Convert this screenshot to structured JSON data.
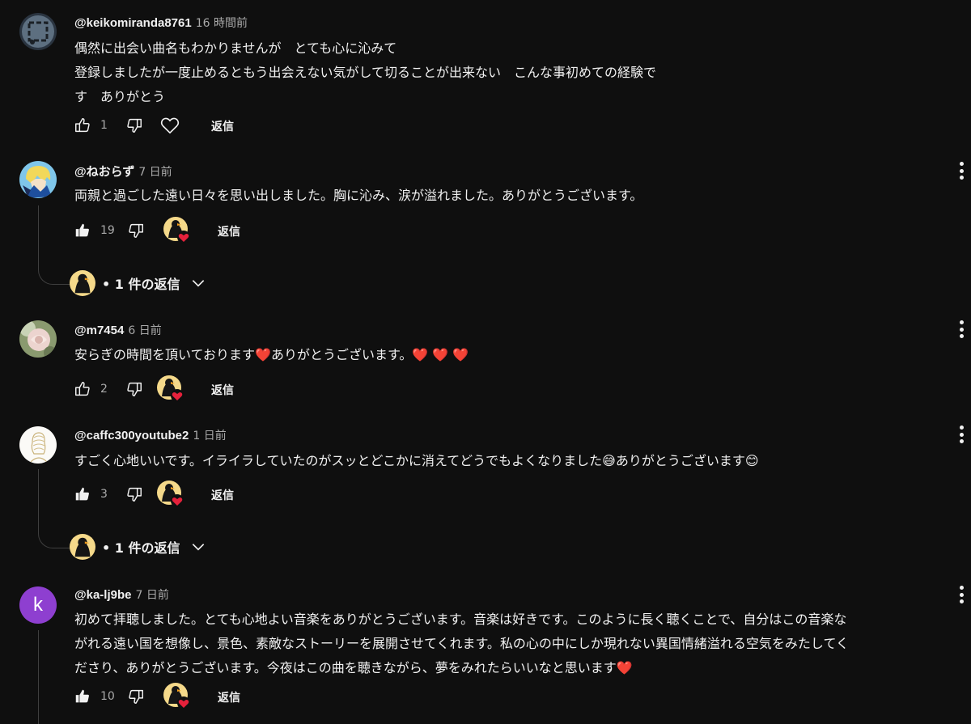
{
  "reply_label": "返信",
  "colors": {
    "background": "#0f0f0f",
    "text": "#f1f1f1",
    "secondary": "#aaaaaa",
    "heart": "#e5213b",
    "k_avatar": "#8e3fd0"
  },
  "comments": [
    {
      "author": "@keikomiranda8761",
      "time": "16 時間前",
      "lines": [
        "偶然に出会い曲名もわかりませんが　とても心に沁みて",
        "登録しましたが一度止めるともう出会えない気がして切ることが出来ない　こんな事初めての経験で",
        "す　ありがとう"
      ],
      "likes": "1",
      "liked": false,
      "creator_heart": false
    },
    {
      "author": "@ねおらず",
      "time": "7 日前",
      "lines": [
        "両親と過ごした遠い日々を思い出しました。胸に沁み、涙が溢れました。ありがとうございます。"
      ],
      "likes": "19",
      "liked": true,
      "creator_heart": true,
      "replies": "• 1 件の返信"
    },
    {
      "author": "@m7454",
      "time": "6 日前",
      "lines": [
        "安らぎの時間を頂いております❤️ありがとうございます。❤️ ❤️ ❤️"
      ],
      "likes": "2",
      "liked": false,
      "creator_heart": true
    },
    {
      "author": "@caffc300youtube2",
      "time": "1 日前",
      "lines": [
        "すごく心地いいです。イライラしていたのがスッとどこかに消えてどうでもよくなりました😅ありがとうございます😊"
      ],
      "likes": "3",
      "liked": true,
      "creator_heart": true,
      "replies": "• 1 件の返信"
    },
    {
      "author": "@ka-lj9be",
      "time": "7 日前",
      "avatar_letter": "k",
      "lines": [
        "初めて拝聴しました。とても心地よい音楽をありがとうございます。音楽は好きです。このように長く聴くことで、自分はこの音楽な",
        "がれる遠い国を想像し、景色、素敵なストーリーを展開させてくれます。私の心の中にしか現れない異国情緒溢れる空気をみたしてく",
        "ださり、ありがとうございます。今夜はこの曲を聴きながら、夢をみれたらいいなと思います❤️"
      ],
      "likes": "10",
      "liked": true,
      "creator_heart": true
    }
  ]
}
